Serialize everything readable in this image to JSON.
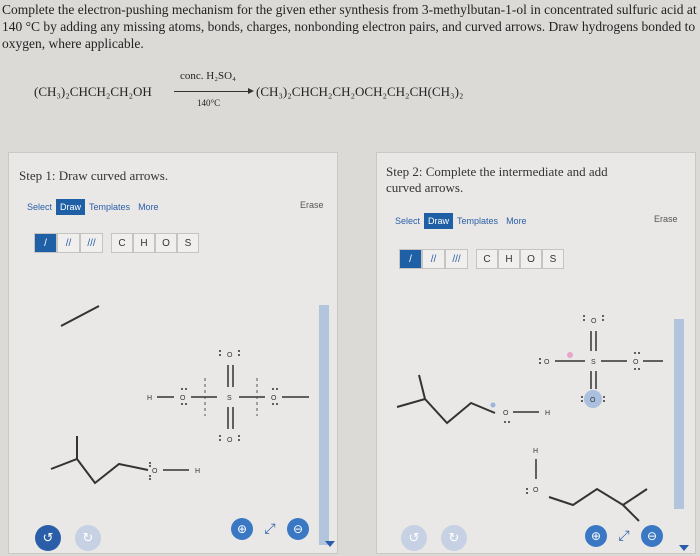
{
  "question": {
    "line1": "Complete the electron-pushing mechanism for the given ether synthesis from 3-methylbutan-1-ol in concentrated sulfuric acid at",
    "line2": "140 °C by adding any missing atoms, bonds, charges, nonbonding electron pairs, and curved arrows. Draw hydrogens bonded to",
    "line3": "oxygen, where applicable."
  },
  "reaction": {
    "reactant": "(CH₃)₂CHCH₂CH₂OH",
    "reagent": "conc. H₂SO₄",
    "condition": "140°C",
    "product": "(CH₃)₂CHCH₂CH₂OCH₂CH₂CH(CH₃)₂"
  },
  "left_panel": {
    "title": "Step 1: Draw curved arrows.",
    "toolbar": {
      "select": "Select",
      "draw": "Draw",
      "templates": "Templates",
      "more": "More",
      "erase": "Erase"
    },
    "bond_tools": [
      "/",
      "//",
      "///"
    ],
    "atoms": [
      "C",
      "H",
      "O",
      "S"
    ],
    "labels": {
      "h": "H",
      "o1": "O",
      "s": "S",
      "o2": "O",
      "o3": "O",
      "o4": "O",
      "o5": "O",
      "h2": "H"
    }
  },
  "right_panel": {
    "title_line1": "Step 2: Complete the intermediate and add",
    "title_line2": "curved arrows.",
    "toolbar": {
      "select": "Select",
      "draw": "Draw",
      "templates": "Templates",
      "more": "More",
      "erase": "Erase"
    },
    "bond_tools": [
      "/",
      "//",
      "///"
    ],
    "atoms": [
      "C",
      "H",
      "O",
      "S"
    ],
    "labels": {
      "o_top": "O",
      "o_left": "O",
      "s": "S",
      "o_right": "O",
      "o_bottom": "O",
      "o_alc": "O",
      "h_alc": "H",
      "h_mid": "H",
      "o_low": "O"
    }
  },
  "colors": {
    "accent": "#1f5fa6",
    "scrollbar": "#b3c4dd",
    "panel": "#e9e8e6"
  }
}
